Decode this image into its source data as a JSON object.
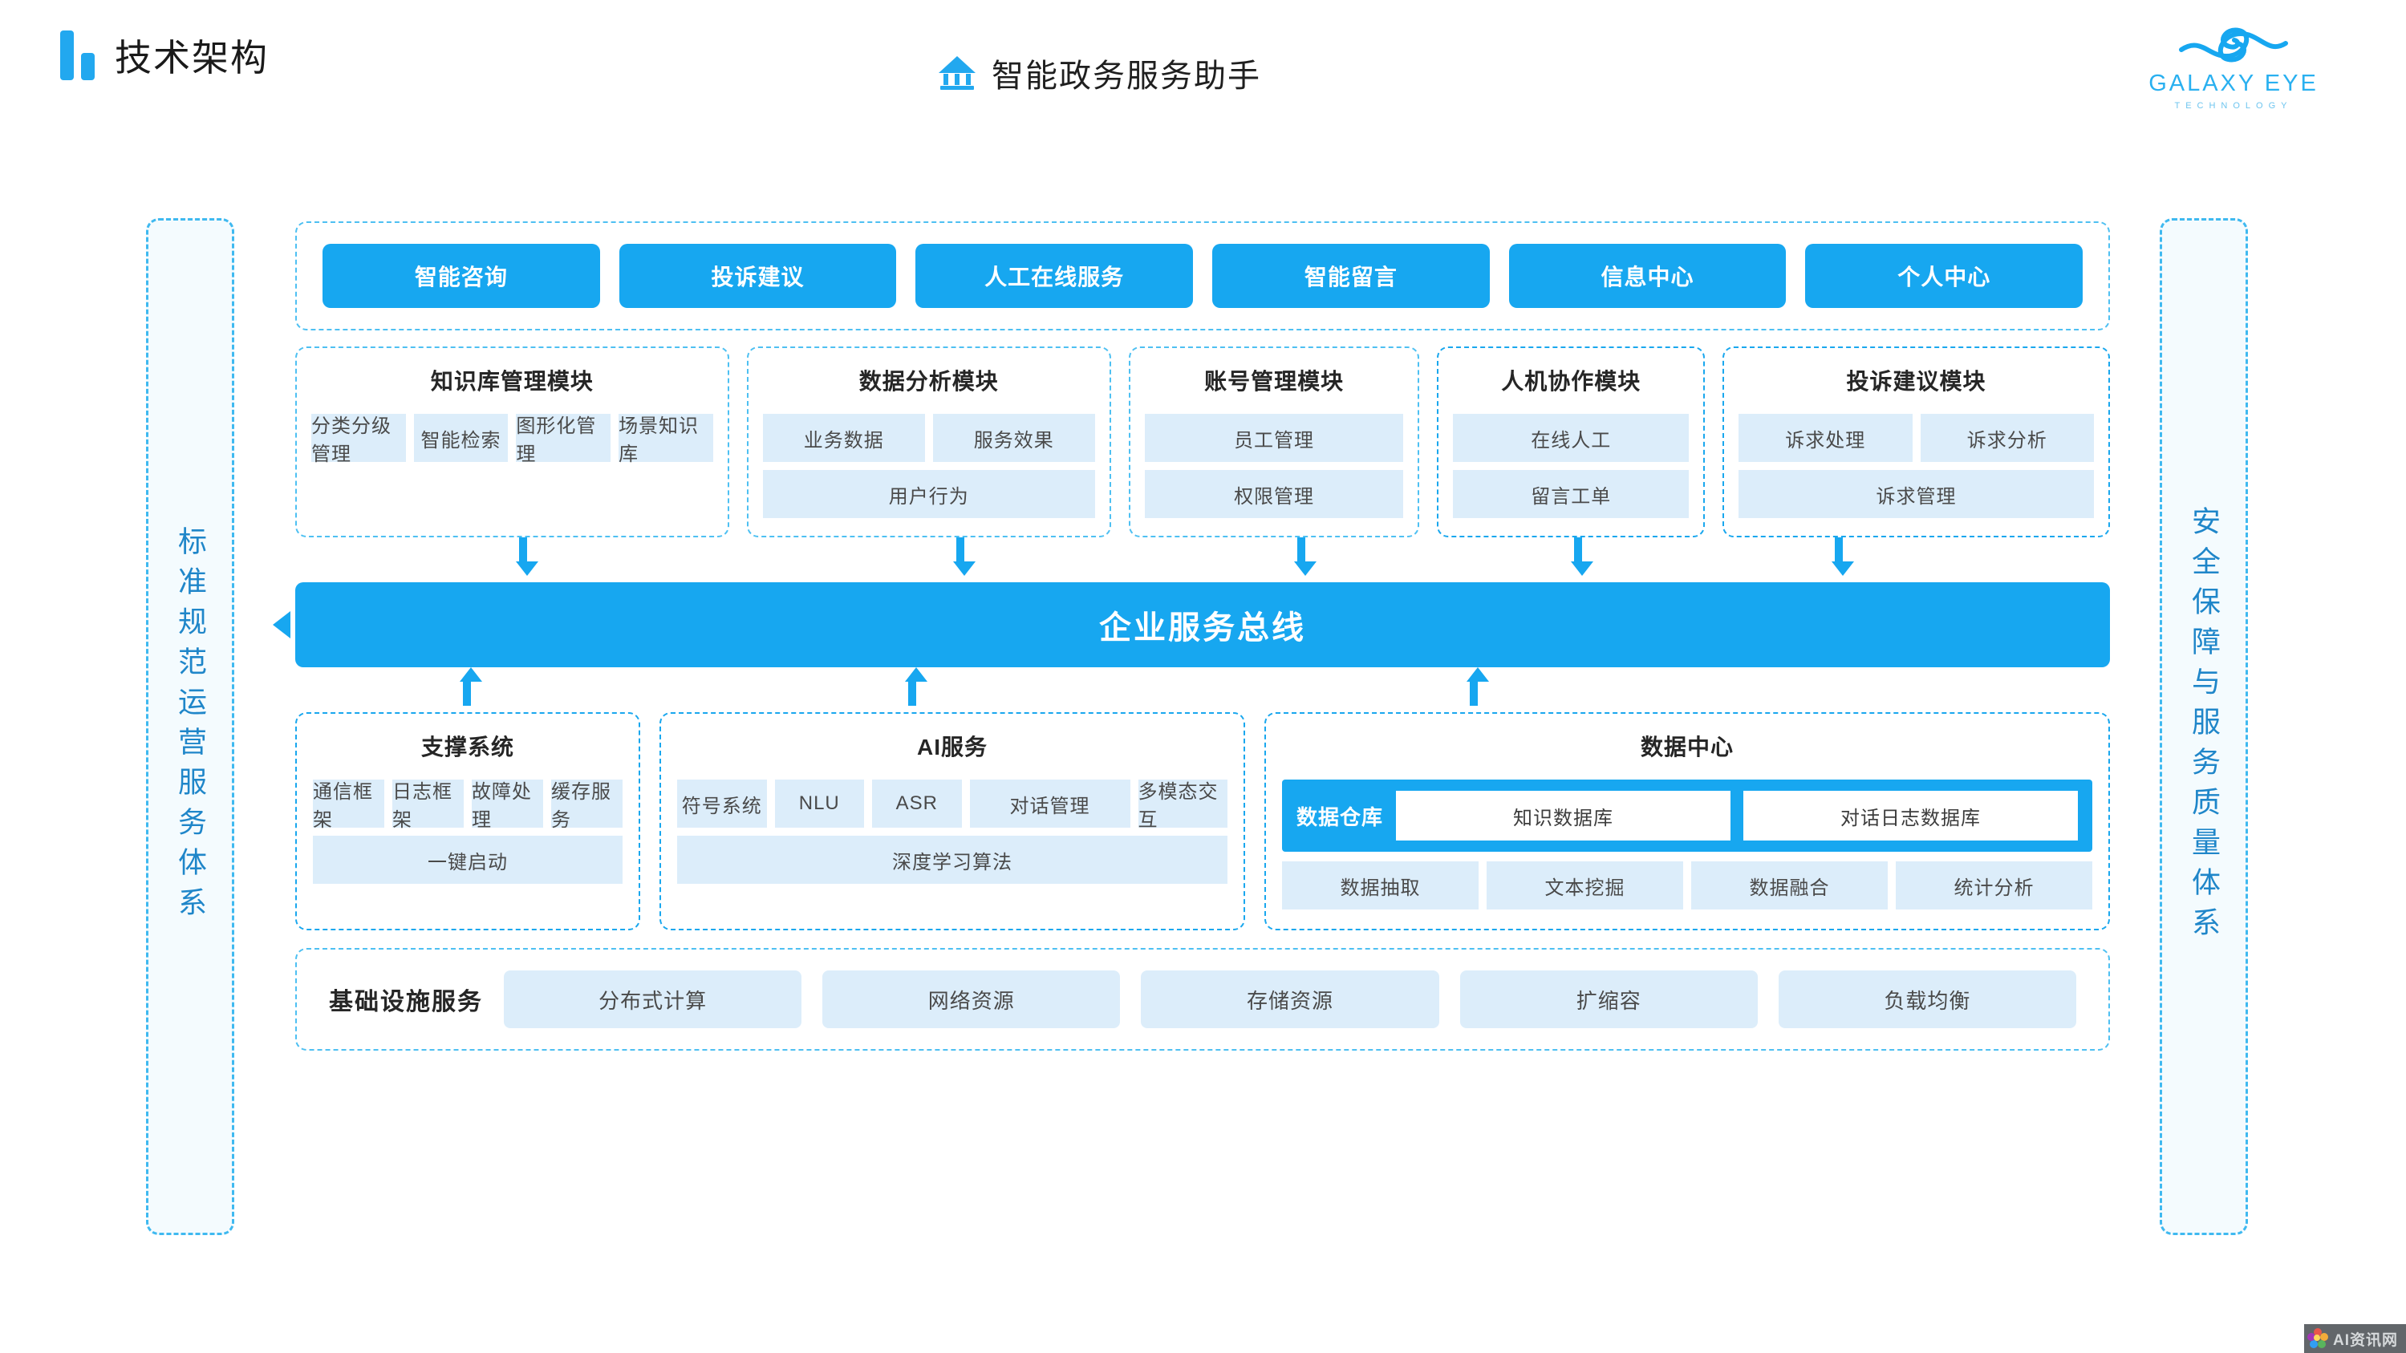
{
  "header": {
    "page_title": "技术架构",
    "center_title": "智能政务服务助手",
    "brand_name": "GALAXY EYE",
    "brand_sub": "TECHNOLOGY"
  },
  "side_panels": {
    "left": "标准规范运营服务体系",
    "right": "安全保障与服务质量体系"
  },
  "entry_buttons": [
    {
      "label": "智能咨询"
    },
    {
      "label": "投诉建议"
    },
    {
      "label": "人工在线服务"
    },
    {
      "label": "智能留言"
    },
    {
      "label": "信息中心"
    },
    {
      "label": "个人中心"
    }
  ],
  "modules": [
    {
      "title": "知识库管理模块",
      "tiles": [
        {
          "label": "分类分级管理",
          "full": false
        },
        {
          "label": "智能检索",
          "full": false
        },
        {
          "label": "图形化管理",
          "full": false
        },
        {
          "label": "场景知识库",
          "full": false
        }
      ]
    },
    {
      "title": "数据分析模块",
      "tiles": [
        {
          "label": "业务数据",
          "full": false
        },
        {
          "label": "服务效果",
          "full": false
        },
        {
          "label": "用户行为",
          "full": true
        }
      ]
    },
    {
      "title": "账号管理模块",
      "tiles": [
        {
          "label": "员工管理",
          "full": true
        },
        {
          "label": "权限管理",
          "full": true
        }
      ]
    },
    {
      "title": "人机协作模块",
      "tiles": [
        {
          "label": "在线人工",
          "full": true
        },
        {
          "label": "留言工单",
          "full": true
        }
      ]
    },
    {
      "title": "投诉建议模块",
      "tiles": [
        {
          "label": "诉求处理",
          "full": false
        },
        {
          "label": "诉求分析",
          "full": false
        },
        {
          "label": "诉求管理",
          "full": true
        }
      ]
    }
  ],
  "bus": {
    "label": "企业服务总线"
  },
  "support": {
    "title": "支撑系统",
    "tiles": [
      {
        "label": "通信框架",
        "full": false
      },
      {
        "label": "日志框架",
        "full": false
      },
      {
        "label": "故障处理",
        "full": false
      },
      {
        "label": "缓存服务",
        "full": false
      },
      {
        "label": "一键启动",
        "full": true
      }
    ]
  },
  "ai_service": {
    "title": "AI服务",
    "row1": [
      {
        "label": "符号系统"
      },
      {
        "label": "NLU"
      },
      {
        "label": "ASR"
      }
    ],
    "row2": [
      {
        "label": "对话管理"
      },
      {
        "label": "多模态交互"
      }
    ],
    "row3": [
      {
        "label": "深度学习算法"
      }
    ]
  },
  "data_center": {
    "title": "数据中心",
    "warehouse_label": "数据仓库",
    "databases": [
      {
        "label": "知识数据库"
      },
      {
        "label": "对话日志数据库"
      }
    ],
    "tiles": [
      {
        "label": "数据抽取"
      },
      {
        "label": "文本挖掘"
      },
      {
        "label": "数据融合"
      },
      {
        "label": "统计分析"
      }
    ]
  },
  "infrastructure": {
    "label": "基础设施服务",
    "tiles": [
      {
        "label": "分布式计算"
      },
      {
        "label": "网络资源"
      },
      {
        "label": "存储资源"
      },
      {
        "label": "扩缩容"
      },
      {
        "label": "负载均衡"
      }
    ]
  },
  "watermark": {
    "text": "AI资讯网"
  },
  "colors": {
    "accent": "#17a7f0",
    "accent_light": "#dcedfa",
    "dashed_border": "#4ec0f2",
    "side_text": "#1f86c9"
  }
}
